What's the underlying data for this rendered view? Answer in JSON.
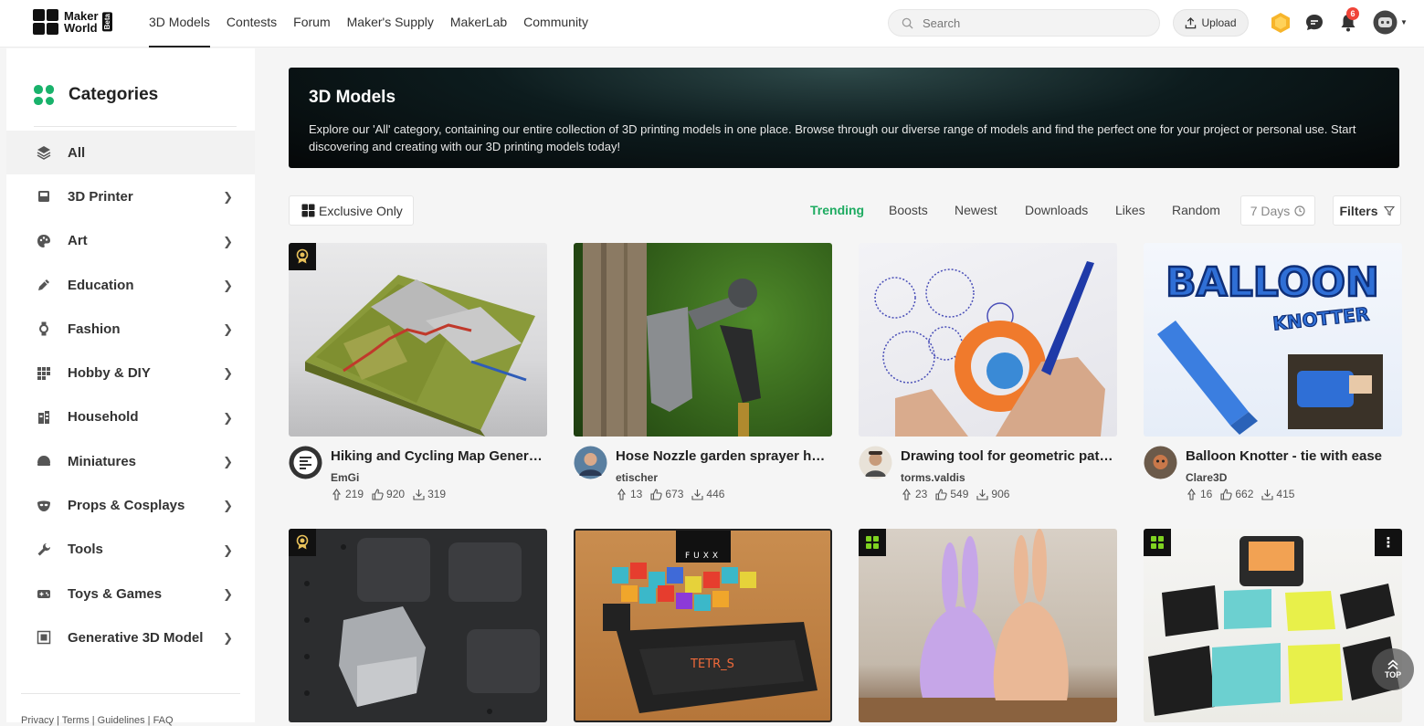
{
  "header": {
    "logo_line1": "Maker",
    "logo_line2": "World",
    "logo_beta": "Beta",
    "nav": [
      "3D Models",
      "Contests",
      "Forum",
      "Maker's Supply",
      "MakerLab",
      "Community"
    ],
    "active_nav": "3D Models",
    "search_placeholder": "Search",
    "upload_label": "Upload",
    "notification_count": "6"
  },
  "sidebar": {
    "title": "Categories",
    "items": [
      {
        "label": "All",
        "icon": "layers-icon"
      },
      {
        "label": "3D Printer",
        "icon": "printer-icon"
      },
      {
        "label": "Art",
        "icon": "palette-icon"
      },
      {
        "label": "Education",
        "icon": "pencil-icon"
      },
      {
        "label": "Fashion",
        "icon": "watch-icon"
      },
      {
        "label": "Hobby & DIY",
        "icon": "grid-icon"
      },
      {
        "label": "Household",
        "icon": "building-icon"
      },
      {
        "label": "Miniatures",
        "icon": "helmet-icon"
      },
      {
        "label": "Props & Cosplays",
        "icon": "mask-icon"
      },
      {
        "label": "Tools",
        "icon": "wrench-icon"
      },
      {
        "label": "Toys & Games",
        "icon": "gamepad-icon"
      },
      {
        "label": "Generative 3D Model",
        "icon": "cube-frame-icon"
      }
    ],
    "footer_links": [
      "Privacy",
      "Terms",
      "Guidelines",
      "FAQ"
    ]
  },
  "banner": {
    "title": "3D Models",
    "description": "Explore our 'All' category, containing our entire collection of 3D printing models in one place. Browse through our diverse range of models and find the perfect one for your project or personal use. Start discovering and creating with our 3D printing models today!"
  },
  "filter_bar": {
    "exclusive_label": "Exclusive Only",
    "sort_options": [
      "Trending",
      "Boosts",
      "Newest",
      "Downloads",
      "Likes",
      "Random"
    ],
    "active_sort": "Trending",
    "period_label": "7 Days",
    "filters_label": "Filters"
  },
  "models": [
    {
      "title": "Hiking and Cycling Map Generator",
      "author": "EmGi",
      "boosts": "219",
      "likes": "920",
      "downloads": "319",
      "badge": "award-badge"
    },
    {
      "title": "Hose Nozzle garden sprayer holder",
      "author": "etischer",
      "boosts": "13",
      "likes": "673",
      "downloads": "446",
      "badge": ""
    },
    {
      "title": "Drawing tool for geometric patterns",
      "author": "torms.valdis",
      "boosts": "23",
      "likes": "549",
      "downloads": "906",
      "badge": ""
    },
    {
      "title": "Balloon Knotter - tie with ease",
      "author": "Clare3D",
      "boosts": "16",
      "likes": "662",
      "downloads": "415",
      "badge": ""
    },
    {
      "badge": "award-badge"
    },
    {
      "badge": ""
    },
    {
      "badge": "exclusive-badge"
    },
    {
      "badge": "exclusive-badge"
    }
  ],
  "thumb_text": {
    "balloon_title": "BALLOON",
    "balloon_subtitle": "KNOTTER",
    "fuxx_logo": "FUXX",
    "tetris_logo": "TETR_S"
  },
  "top_button_label": "TOP"
}
